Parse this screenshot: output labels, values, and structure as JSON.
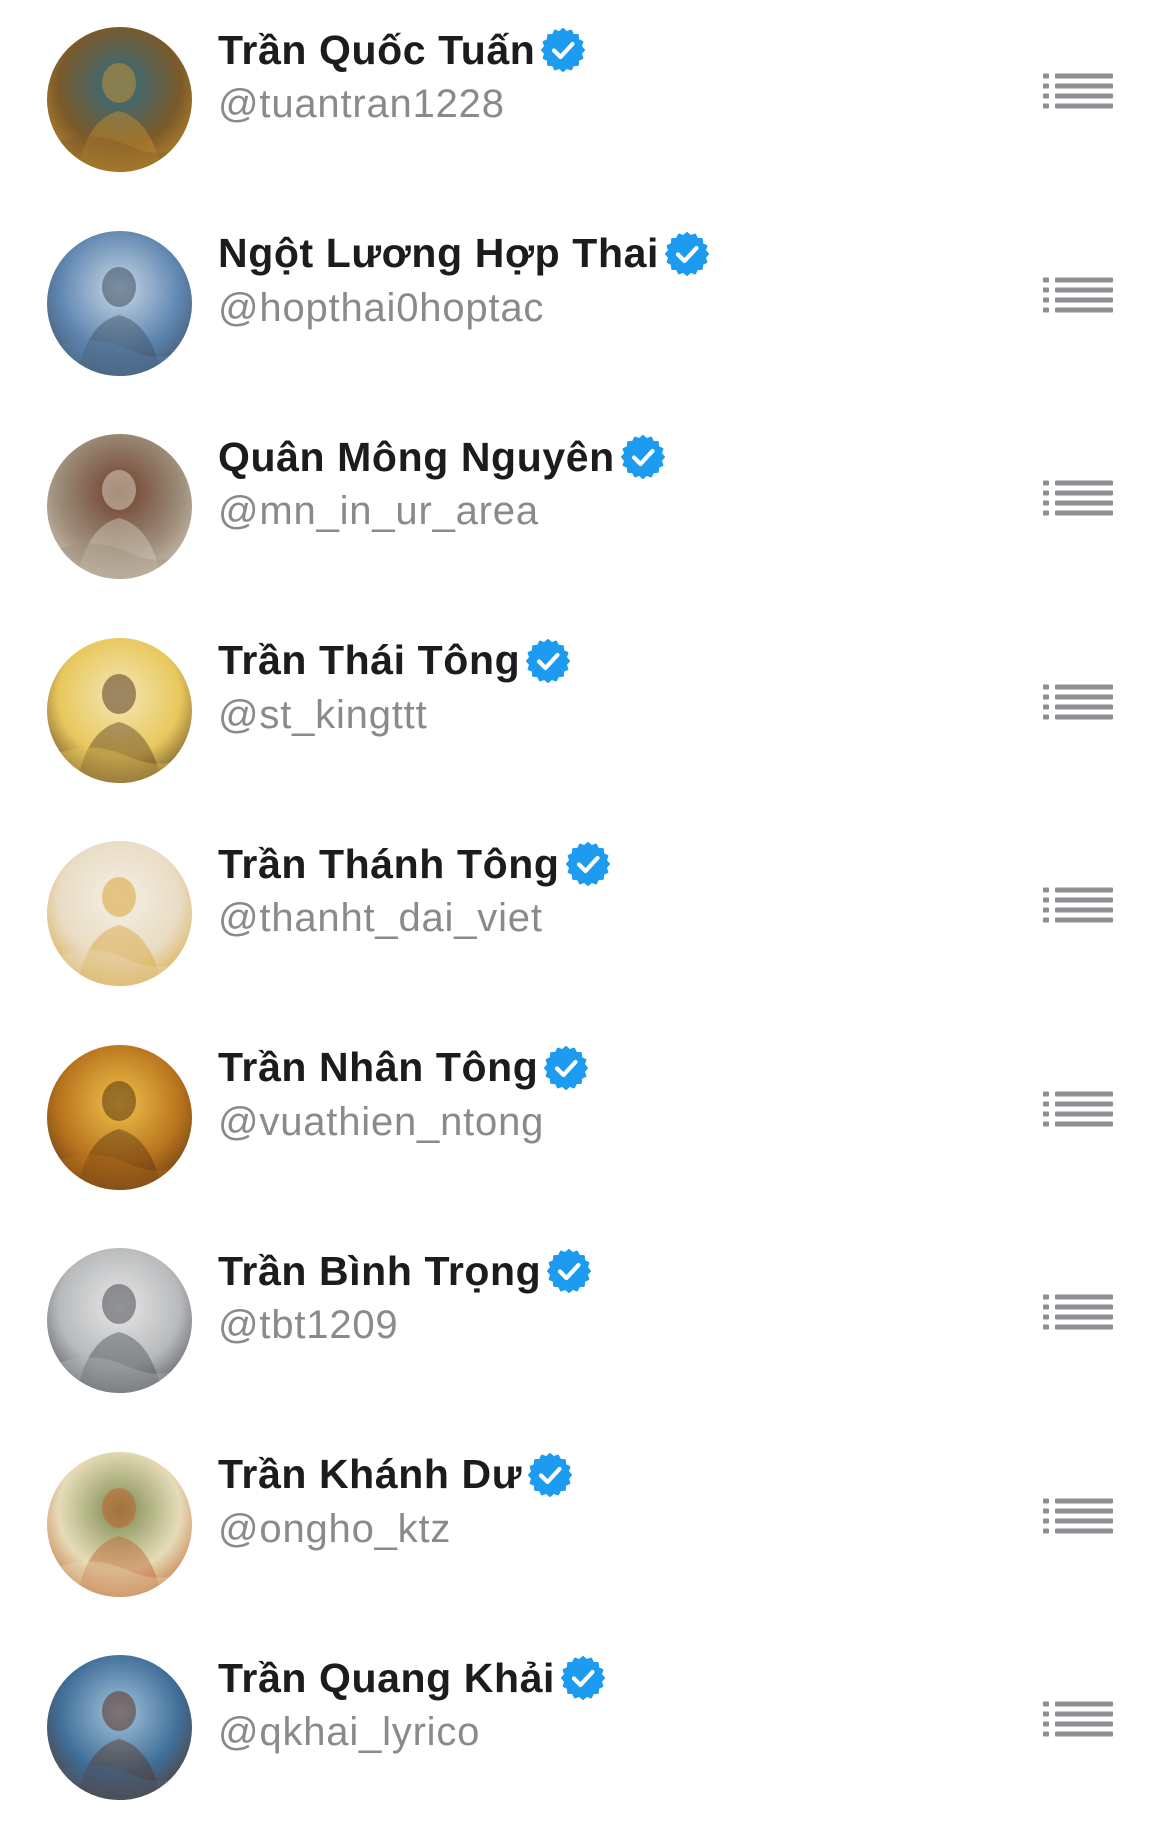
{
  "accounts": [
    {
      "name": "Trần Quốc Tuấn",
      "handle": "@tuantran1228",
      "avatar_icon": "warrior-general-portrait",
      "colors": [
        "#7a5a2a",
        "#2f6d86",
        "#c9902e"
      ]
    },
    {
      "name": "Ngột Lương Hợp Thai",
      "handle": "@hopthai0hoptac",
      "avatar_icon": "naval-battle-painting",
      "colors": [
        "#5f86b0",
        "#c9d8e6",
        "#3c4e62"
      ]
    },
    {
      "name": "Quân Mông Nguyên",
      "handle": "@mn_in_ur_area",
      "avatar_icon": "mounted-archers-painting",
      "colors": [
        "#9b8b78",
        "#6f3f2c",
        "#d8cdbe"
      ]
    },
    {
      "name": "Trần Thái Tông",
      "handle": "@st_kingttt",
      "avatar_icon": "emperor-on-throne-portrait",
      "colors": [
        "#e8c85c",
        "#f3e6b6",
        "#5a3c22"
      ]
    },
    {
      "name": "Trần Thánh Tông",
      "handle": "@thanht_dai_viet",
      "avatar_icon": "young-emperor-portrait",
      "colors": [
        "#e9dcc3",
        "#f4efe6",
        "#d9a437"
      ]
    },
    {
      "name": "Trần Nhân Tông",
      "handle": "@vuathien_ntong",
      "avatar_icon": "golden-robed-emperor-portrait",
      "colors": [
        "#b9741e",
        "#f0c24a",
        "#5a3410"
      ]
    },
    {
      "name": "Trần Bình Trọng",
      "handle": "@tbt1209",
      "avatar_icon": "armored-knight-horse-portrait",
      "colors": [
        "#b7b9bb",
        "#e7e7e7",
        "#4a4d52"
      ]
    },
    {
      "name": "Trần Khánh Dư",
      "handle": "@ongho_ktz",
      "avatar_icon": "general-with-falcon-portrait",
      "colors": [
        "#e6dcb8",
        "#7b8a4f",
        "#c0622e"
      ]
    },
    {
      "name": "Trần Quang Khải",
      "handle": "@qkhai_lyrico",
      "avatar_icon": "swordsman-battle-portrait",
      "colors": [
        "#3e6e98",
        "#a6c4dc",
        "#5b3320"
      ]
    }
  ],
  "theme": {
    "verified_color": "#1d9bf0",
    "menu_icon_color": "#8e8e93",
    "name_color": "#1c1c1e",
    "handle_color": "#8a8a8e"
  }
}
